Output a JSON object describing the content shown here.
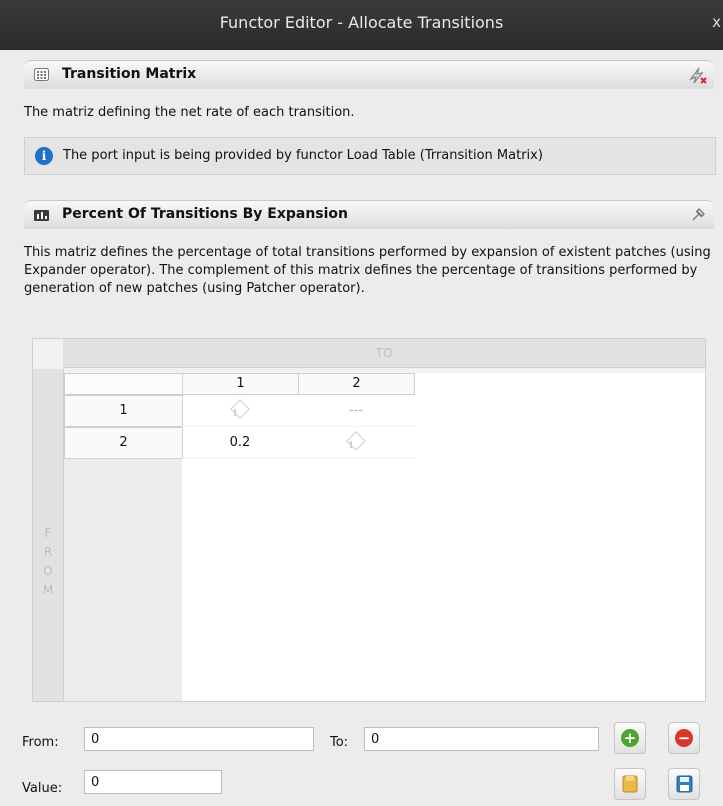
{
  "window": {
    "title": "Functor Editor - Allocate Transitions",
    "close_glyph": "x"
  },
  "transition_matrix": {
    "title": "Transition Matrix",
    "description": "The matriz defining the net rate of each transition.",
    "info": "The port input is being provided by functor Load Table (Trransition Matrix)",
    "icons": [
      "grid-icon",
      "unlink-icon",
      "info-icon"
    ]
  },
  "percent_section": {
    "title": "Percent Of Transitions By Expansion",
    "description": "This matriz defines the percentage of total transitions performed by expansion of existent patches (using Expander operator). The complement of this matrix defines the percentage of transitions performed by generation of new patches (using Patcher operator).",
    "icons": [
      "matrix-chart-icon",
      "detach-icon"
    ]
  },
  "matrix": {
    "to_label": "TO",
    "from_label": "FROM",
    "from_letters": [
      "F",
      "R",
      "O",
      "M"
    ],
    "columns": [
      "1",
      "2"
    ],
    "rows": [
      {
        "label": "1",
        "cells": [
          "",
          "---"
        ]
      },
      {
        "label": "2",
        "cells": [
          "0.2",
          ""
        ]
      }
    ],
    "missing_value_icon": "warning-diamond-icon"
  },
  "form": {
    "from_label": "From:",
    "from_value": "0",
    "to_label": "To:",
    "to_value": "0",
    "value_label": "Value:",
    "value_value": "0",
    "icons": [
      "add-icon",
      "remove-icon",
      "open-icon",
      "save-icon"
    ],
    "colors": {
      "add": "#4aa82e",
      "remove": "#d8372b",
      "open": "#e9b949",
      "save": "#2f7fc4"
    }
  }
}
